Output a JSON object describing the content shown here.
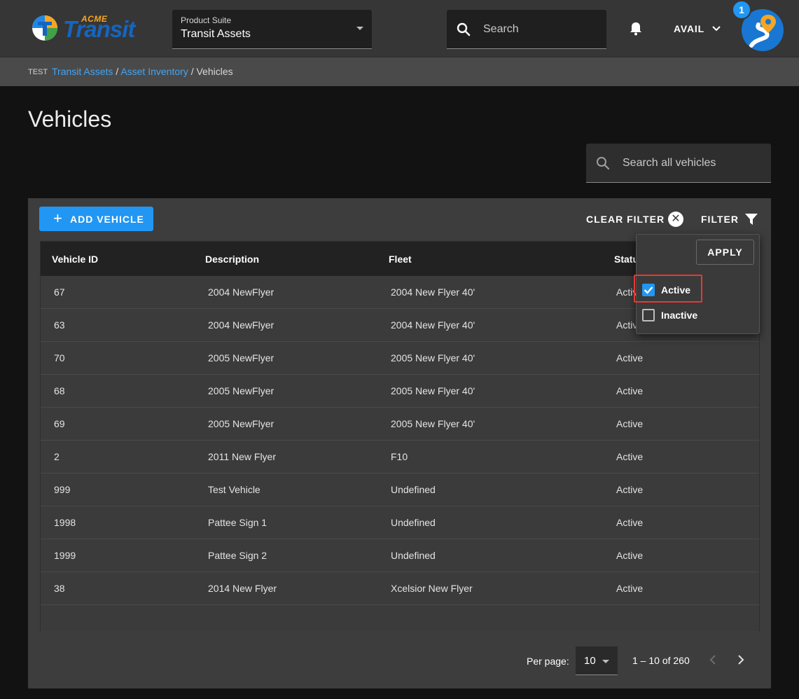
{
  "app": {
    "logo_top": "ACME",
    "logo_main": "Transit",
    "product_label": "Product Suite",
    "product_value": "Transit Assets",
    "search_placeholder": "Search",
    "user": "AVAIL",
    "notification_count": "1"
  },
  "breadcrumb": {
    "env": "TEST",
    "items": [
      "Transit Assets",
      "Asset Inventory",
      "Vehicles"
    ],
    "separator": " / "
  },
  "page": {
    "title": "Vehicles",
    "search_placeholder": "Search all vehicles",
    "add_label": "ADD VEHICLE",
    "clear_filter_label": "CLEAR FILTER",
    "filter_label": "FILTER"
  },
  "table": {
    "columns": [
      "Vehicle ID",
      "Description",
      "Fleet",
      "Status"
    ],
    "rows": [
      {
        "id": "67",
        "desc": "2004 NewFlyer",
        "fleet": "2004 New Flyer 40'",
        "status": "Active"
      },
      {
        "id": "63",
        "desc": "2004 NewFlyer",
        "fleet": "2004 New Flyer 40'",
        "status": "Active"
      },
      {
        "id": "70",
        "desc": "2005 NewFlyer",
        "fleet": "2005 New Flyer 40'",
        "status": "Active"
      },
      {
        "id": "68",
        "desc": "2005 NewFlyer",
        "fleet": "2005 New Flyer 40'",
        "status": "Active"
      },
      {
        "id": "69",
        "desc": "2005 NewFlyer",
        "fleet": "2005 New Flyer 40'",
        "status": "Active"
      },
      {
        "id": "2",
        "desc": "2011 New Flyer",
        "fleet": "F10",
        "status": "Active"
      },
      {
        "id": "999",
        "desc": "Test Vehicle",
        "fleet": "Undefined",
        "status": "Active"
      },
      {
        "id": "1998",
        "desc": "Pattee Sign 1",
        "fleet": "Undefined",
        "status": "Active"
      },
      {
        "id": "1999",
        "desc": "Pattee Sign 2",
        "fleet": "Undefined",
        "status": "Active"
      },
      {
        "id": "38",
        "desc": "2014 New Flyer",
        "fleet": "Xcelsior New Flyer",
        "status": "Active"
      }
    ]
  },
  "pagination": {
    "per_page_label": "Per page:",
    "per_page_value": "10",
    "range": "1 – 10 of 260"
  },
  "filter_popup": {
    "apply_label": "APPLY",
    "options": [
      {
        "label": "Active",
        "checked": true
      },
      {
        "label": "Inactive",
        "checked": false
      }
    ]
  },
  "colors": {
    "accent": "#2196f3",
    "link": "#42a5f5",
    "highlight": "#e53935"
  }
}
